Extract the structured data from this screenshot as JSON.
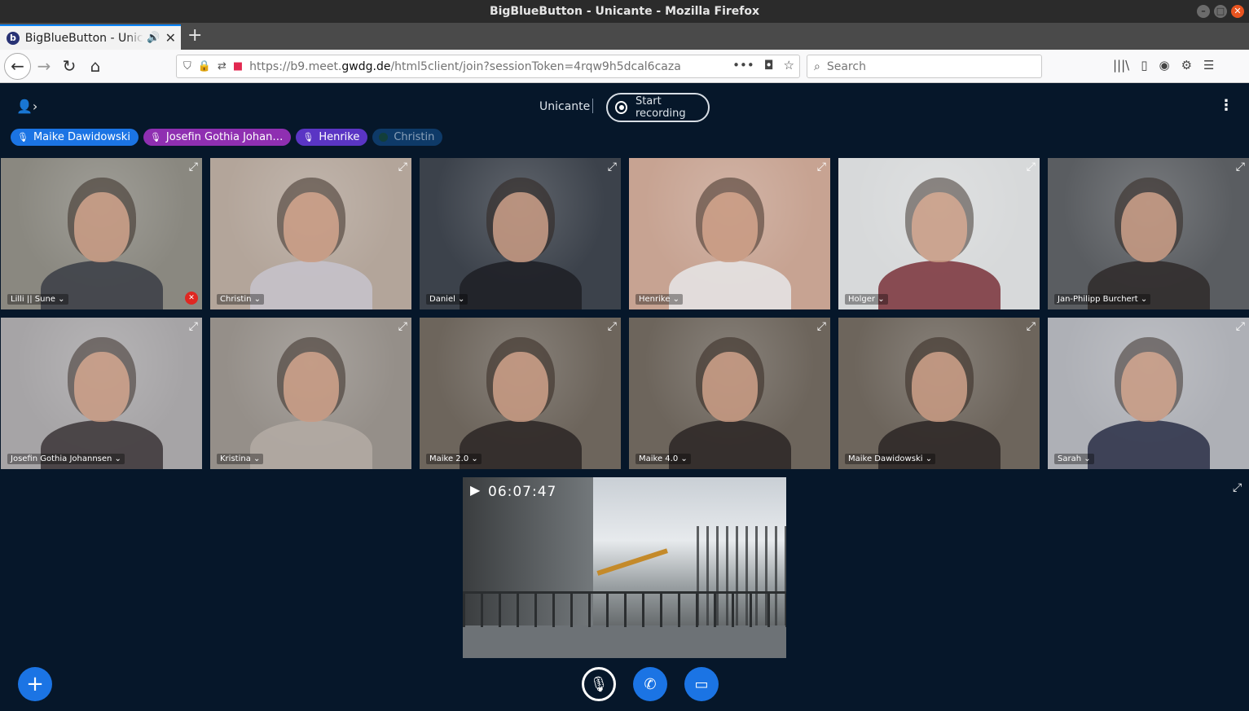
{
  "window": {
    "title": "BigBlueButton - Unicante - Mozilla Firefox",
    "controls": [
      "–",
      "□",
      "✕"
    ]
  },
  "tab": {
    "title": "BigBlueButton - Unicante",
    "audio_icon": "speaker-icon",
    "close": "✕",
    "newtab": "+"
  },
  "nav": {
    "back": "←",
    "forward": "→",
    "reload": "↻",
    "home": "⌂",
    "url_prefix": "https://b9.meet.",
    "url_domain": "gwdg.de",
    "url_suffix": "/html5client/join?sessionToken=4rqw9h5dcal6caza",
    "search_placeholder": "Search",
    "more": "•••",
    "pocket": "◘",
    "bookmark": "☆",
    "tools": [
      "|||\\",
      "▯",
      "◉",
      "⚙",
      "☰"
    ]
  },
  "app": {
    "meeting_name": "Unicante",
    "record_label": "Start recording",
    "talkers": [
      {
        "name": "Maike Dawidowski",
        "color": "#1b74e4",
        "type": "mic"
      },
      {
        "name": "Josefin Gothia Johan…",
        "color": "#8f2fb1",
        "type": "mic"
      },
      {
        "name": "Henrike",
        "color": "#5a35c4",
        "type": "mic"
      },
      {
        "name": "Christin",
        "color": "#0e3a68",
        "type": "dot"
      }
    ],
    "tiles": [
      {
        "name": "Lilli || Sune",
        "bg": "#8a8880",
        "shirt": "#3a3d45",
        "muted": true
      },
      {
        "name": "Christin",
        "bg": "#b3a59a",
        "shirt": "#c7c3cc",
        "muted": false
      },
      {
        "name": "Daniel",
        "bg": "#3c424b",
        "shirt": "#1d1f24",
        "muted": false
      },
      {
        "name": "Henrike",
        "bg": "#c7a392",
        "shirt": "#e6e6e8",
        "muted": false
      },
      {
        "name": "Holger",
        "bg": "#d7d9da",
        "shirt": "#7a3139",
        "muted": false
      },
      {
        "name": "Jan-Philipp Burchert",
        "bg": "#5a5d61",
        "shirt": "#2f2a2a",
        "muted": false
      },
      {
        "name": "Josefin Gothia Johannsen",
        "bg": "#a6a4a6",
        "shirt": "#3b3537",
        "muted": false
      },
      {
        "name": "Kristina",
        "bg": "#958f89",
        "shirt": "#b4aca5",
        "muted": false
      },
      {
        "name": "Maike 2.0",
        "bg": "#6d655c",
        "shirt": "#2b2624",
        "muted": false
      },
      {
        "name": "Maike 4.0",
        "bg": "#6d655c",
        "shirt": "#2b2624",
        "muted": false
      },
      {
        "name": "Maike Dawidowski",
        "bg": "#6d655c",
        "shirt": "#2b2624",
        "muted": false
      },
      {
        "name": "Sarah",
        "bg": "#aeb0b6",
        "shirt": "#2a2f46",
        "muted": false
      }
    ],
    "screenshare_time": "06:07:47"
  }
}
